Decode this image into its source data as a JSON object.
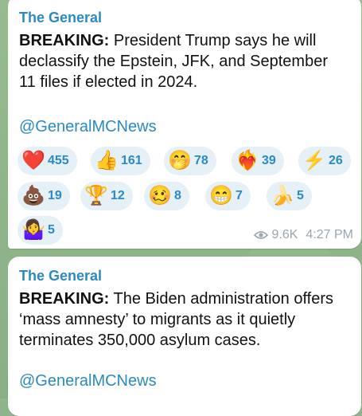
{
  "messages": [
    {
      "sender": "The General",
      "bold": "BREAKING:",
      "text": " President Trump says he will declassify the Epstein, JFK, and September 11 files if elected in 2024.",
      "link": "@GeneralMCNews",
      "reactions": [
        {
          "icon": "red-heart",
          "glyph": "❤️",
          "count": "455"
        },
        {
          "icon": "thumbs-up",
          "glyph": "👍",
          "count": "161"
        },
        {
          "icon": "face-with-hand-over-mouth",
          "glyph": "🤭",
          "count": "78"
        },
        {
          "icon": "heart-on-fire",
          "glyph": "❤️‍🔥",
          "count": "39"
        },
        {
          "icon": "lightning",
          "glyph": "⚡",
          "count": "26"
        },
        {
          "icon": "pile-of-poo",
          "glyph": "💩",
          "count": "19"
        },
        {
          "icon": "trophy",
          "glyph": "🏆",
          "count": "12"
        },
        {
          "icon": "woozy-face",
          "glyph": "🥴",
          "count": "8"
        },
        {
          "icon": "grinning-face",
          "glyph": "😁",
          "count": "7"
        },
        {
          "icon": "banana",
          "glyph": "🍌",
          "count": "5"
        },
        {
          "icon": "person-shrugging",
          "glyph": "🤷‍♀️",
          "count": "5"
        }
      ],
      "views": "9.6K",
      "time": "4:27 PM"
    },
    {
      "sender": "The General",
      "bold": "BREAKING:",
      "text": " The Biden administration offers ‘mass amnesty’ to migrants as it quietly terminates 350,000 asylum cases.",
      "link": "@GeneralMCNews"
    }
  ],
  "colors": {
    "accent": "#2b8ac4",
    "reaction_bg": "#e6f0f7",
    "chat_bg": "#8fb38a"
  }
}
